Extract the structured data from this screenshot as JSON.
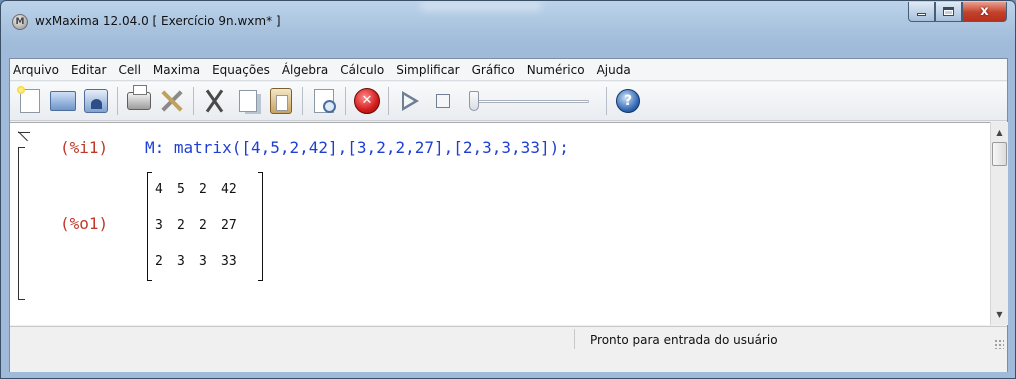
{
  "window": {
    "title": "wxMaxima 12.04.0  [ Exercício 9n.wxm* ]",
    "app_icon_letter": "M",
    "close_glyph": "x"
  },
  "menubar": {
    "items": [
      "Arquivo",
      "Editar",
      "Cell",
      "Maxima",
      "Equações",
      "Álgebra",
      "Cálculo",
      "Simplificar",
      "Gráfico",
      "Numérico",
      "Ajuda"
    ]
  },
  "toolbar": {
    "icons": [
      "new-document-icon",
      "open-folder-icon",
      "save-icon",
      "print-icon",
      "preferences-tools-icon",
      "cut-icon",
      "copy-icon",
      "paste-icon",
      "find-icon",
      "interrupt-stop-icon",
      "animation-play-icon",
      "animation-stop-icon",
      "help-icon"
    ],
    "stop_glyph": "✕",
    "help_glyph": "?",
    "slider_level": 0
  },
  "worksheet": {
    "input_label": "(%i1)",
    "input_code": "M: matrix([4,5,2,42],[3,2,2,27],[2,3,3,33]);",
    "output_label": "(%o1)",
    "matrix": [
      [
        "4",
        "5",
        "2",
        "42"
      ],
      [
        "3",
        "2",
        "2",
        "27"
      ],
      [
        "2",
        "3",
        "3",
        "33"
      ]
    ]
  },
  "statusbar": {
    "text": "Pronto para entrada do usuário"
  },
  "colors": {
    "input_label": "#c0392b",
    "input_code": "#1f3fd4",
    "close_button": "#c3412a"
  }
}
